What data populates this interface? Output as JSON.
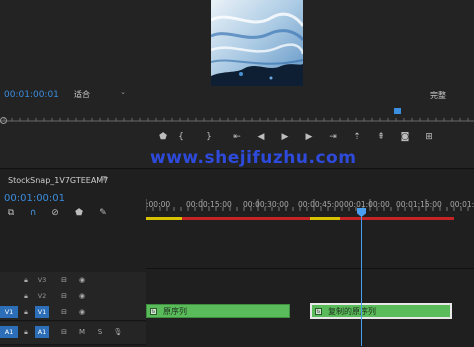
{
  "monitor": {
    "timecode": "00:01:00:01",
    "fit_value": "适合",
    "quality_value": "完整"
  },
  "transport": {
    "icons": [
      "marker-icon",
      "in-point-icon",
      "out-point-icon",
      "go-to-in-icon",
      "step-back-icon",
      "play-icon",
      "step-forward-icon",
      "go-to-out-icon",
      "lift-icon",
      "extract-icon",
      "export-frame-icon",
      "button-editor-icon"
    ]
  },
  "watermark": "www.shejifuzhu.com",
  "timeline": {
    "sequence_tab": "StockSnap_1V7GTEEAM7",
    "menu_glyph": "≡",
    "timecode": "00:01:00:01",
    "ruler_labels": [
      ":00:00",
      "00:00:15:00",
      "00:00:30:00",
      "00:00:45:00",
      "00:01:00:00",
      "00:01:15:00",
      "00:01:30"
    ],
    "tracks": [
      {
        "src": "",
        "name": "V3"
      },
      {
        "src": "",
        "name": "V2"
      },
      {
        "src": "V1",
        "name": "V1"
      },
      {
        "src": "A1",
        "name": "A1"
      }
    ],
    "audio_buttons": {
      "mute": "M",
      "solo": "S"
    },
    "clips": [
      {
        "label": "原序列"
      },
      {
        "label": "复制的原序列"
      }
    ]
  },
  "colors": {
    "accent_blue": "#3a8ddf",
    "clip_green": "#5abb5a",
    "render_red": "#c42424",
    "render_yellow": "#d8c200",
    "watermark_blue": "#2f4ff0"
  }
}
